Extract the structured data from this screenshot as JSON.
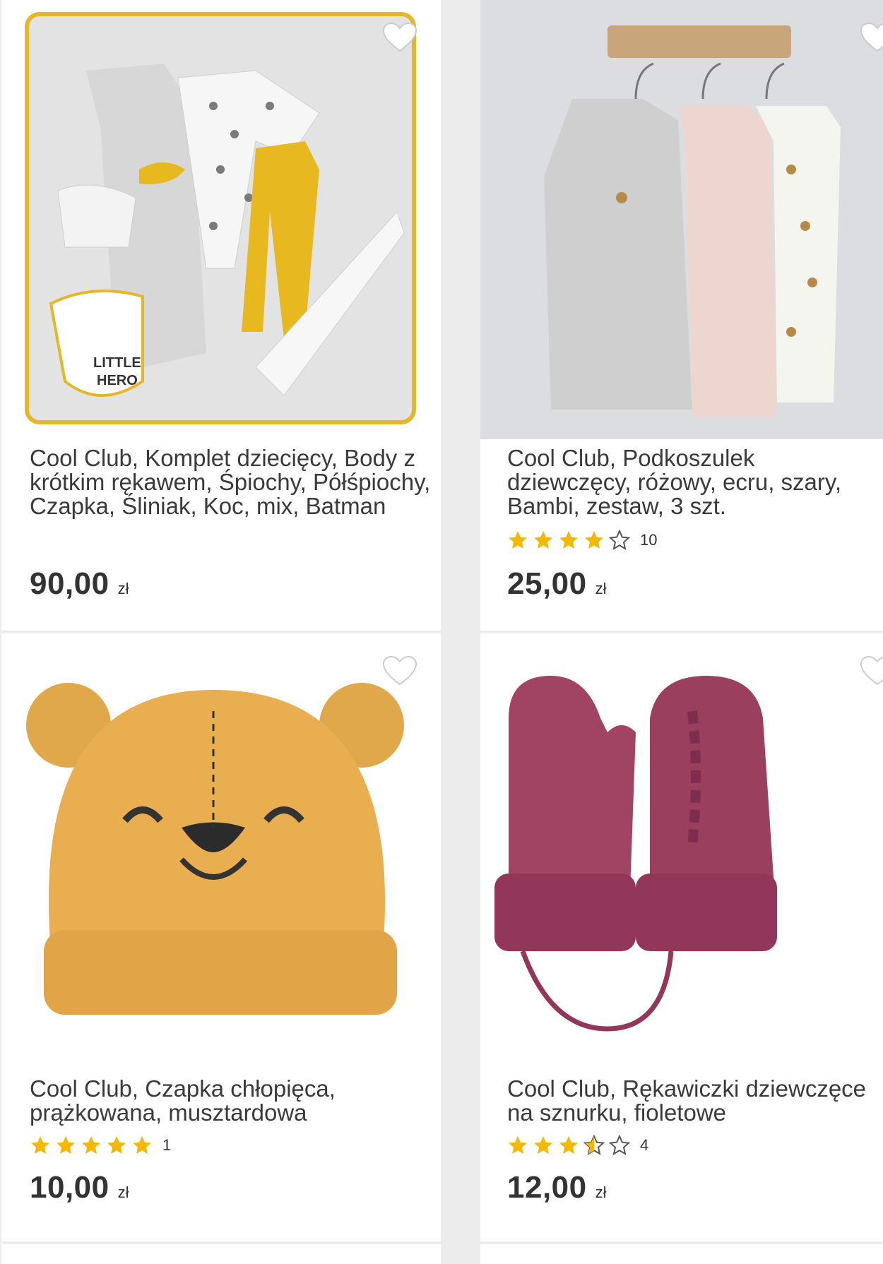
{
  "products": [
    {
      "title": "Cool Club, Komplet dziecięcy, Body z krótkim rękawem, Śpiochy, Półśpiochy, Czapka, Śliniak, Koc, mix, Batman",
      "price": "90,00",
      "currency": "zł",
      "rating": null,
      "review_count": null,
      "image": "batman-baby-set-image"
    },
    {
      "title": "Cool Club, Podkoszulek dziewczęcy, różowy, ecru, szary, Bambi, zestaw, 3 szt.",
      "price": "25,00",
      "currency": "zł",
      "rating": 4,
      "review_count": "10",
      "image": "bambi-tops-image"
    },
    {
      "title": "Cool Club, Czapka chłopięca, prążkowana, musztardowa",
      "price": "10,00",
      "currency": "zł",
      "rating": 5,
      "review_count": "1",
      "image": "mustard-bear-hat-image"
    },
    {
      "title": "Cool Club, Rękawiczki dziewczęce na sznurku, fioletowe",
      "price": "12,00",
      "currency": "zł",
      "rating": 3.5,
      "review_count": "4",
      "image": "purple-mittens-image"
    }
  ],
  "colors": {
    "star": "#f5b800",
    "star_empty_stroke": "#555555",
    "text": "#3a3a3a"
  }
}
